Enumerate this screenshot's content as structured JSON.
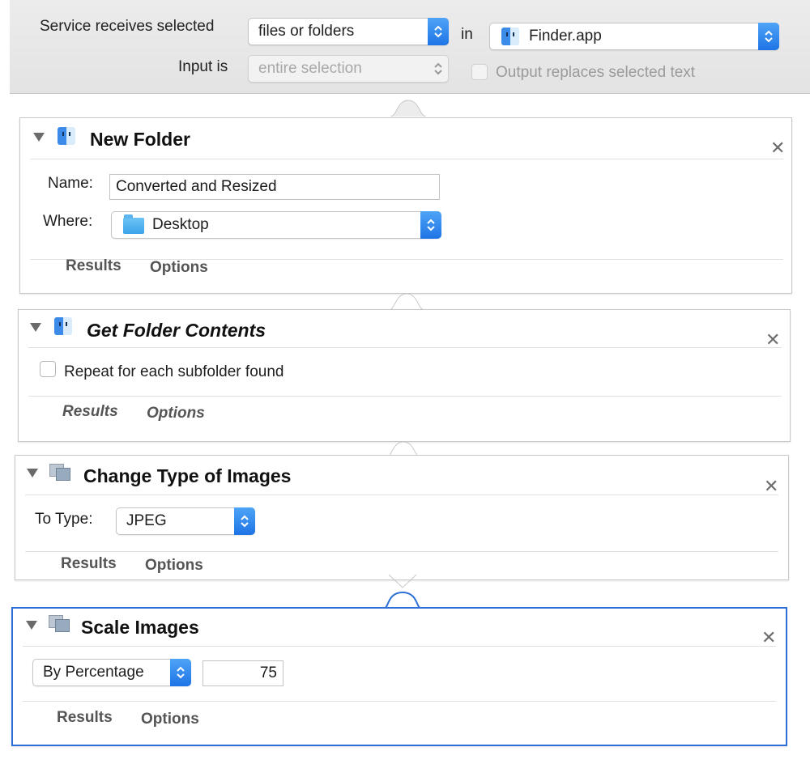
{
  "service": {
    "receives_label": "Service receives selected",
    "input_type": "files or folders",
    "in_label": "in",
    "application": "Finder.app",
    "input_is_label": "Input is",
    "input_is_value": "entire selection",
    "output_replaces_label": "Output replaces selected text"
  },
  "actions": [
    {
      "title": "New Folder",
      "name_label": "Name:",
      "name_value": "Converted and Resized",
      "where_label": "Where:",
      "where_value": "Desktop",
      "results_tab": "Results",
      "options_tab": "Options"
    },
    {
      "title": "Get Folder Contents",
      "repeat_label": "Repeat for each subfolder found",
      "results_tab": "Results",
      "options_tab": "Options"
    },
    {
      "title": "Change Type of Images",
      "to_type_label": "To Type:",
      "to_type_value": "JPEG",
      "results_tab": "Results",
      "options_tab": "Options"
    },
    {
      "title": "Scale Images",
      "scale_mode": "By Percentage",
      "scale_value": "75",
      "results_tab": "Results",
      "options_tab": "Options"
    }
  ],
  "icons": {
    "finder": "finder-icon",
    "folder": "folder-icon",
    "images": "images-icon",
    "close": "close-icon",
    "disclosure": "disclosure-triangle-icon",
    "stepper": "stepper-icon"
  },
  "colors": {
    "accent": "#2c6fd6",
    "stepper_blue": "#1f74e6",
    "bar_gray": "#e6e6e6"
  }
}
